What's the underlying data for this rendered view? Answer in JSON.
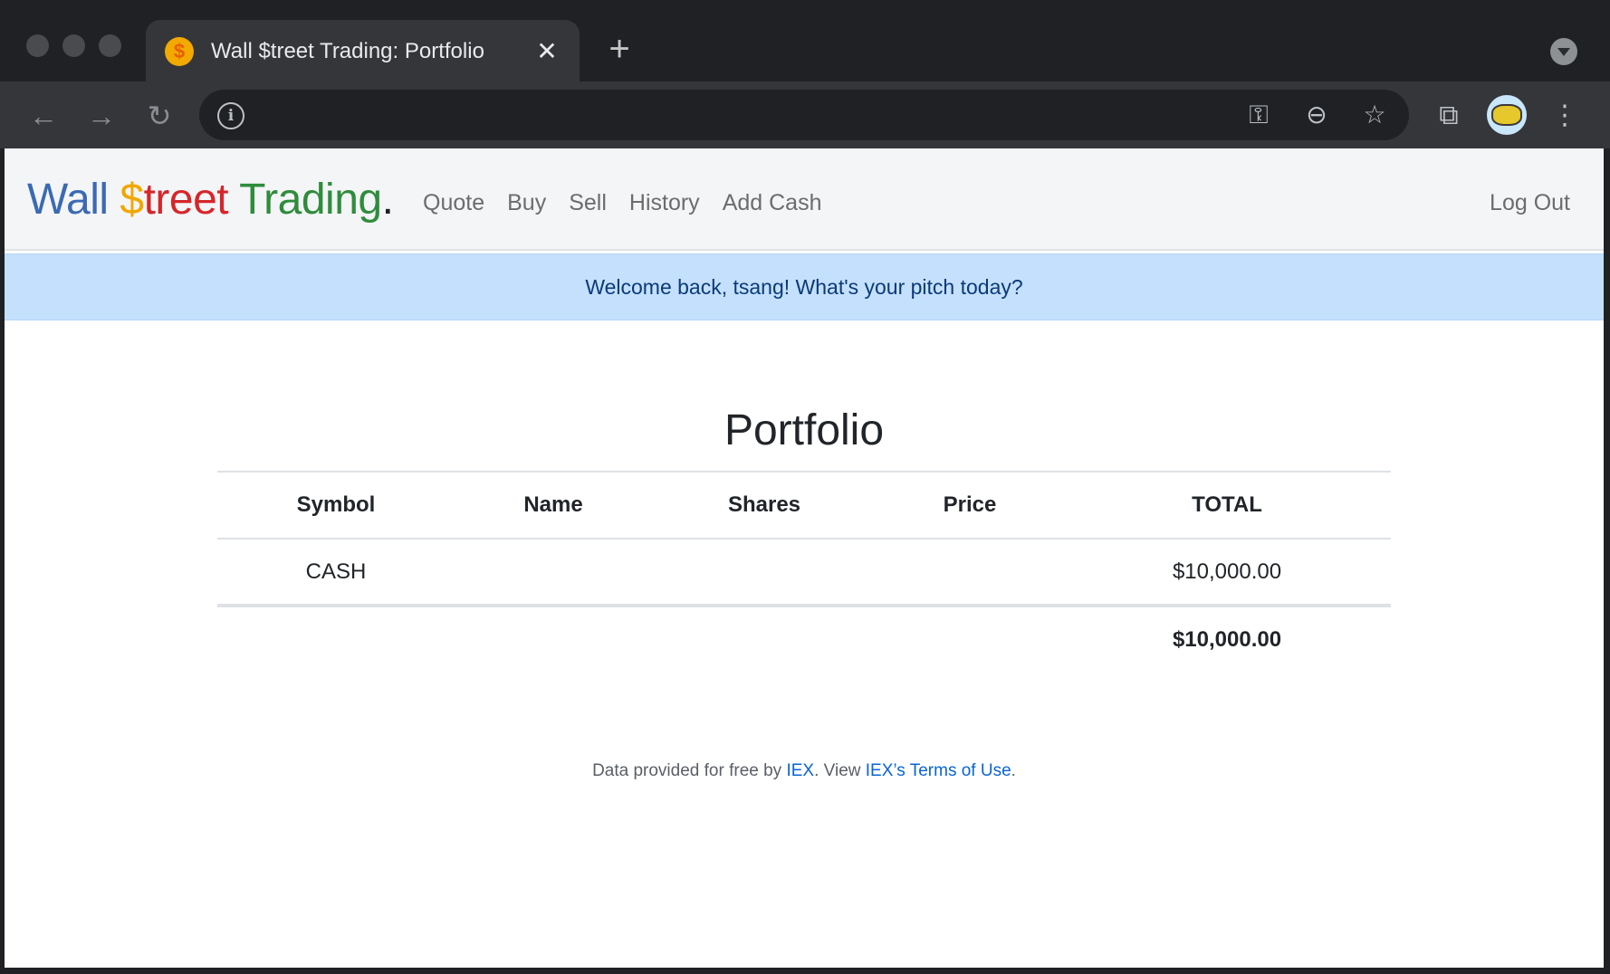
{
  "browser": {
    "tab_title": "Wall $treet Trading: Portfolio",
    "tab_close": "✕",
    "new_tab": "+",
    "nav_back": "←",
    "nav_forward": "→",
    "nav_reload": "↻",
    "info_glyph": "i",
    "key_glyph": "⚿",
    "zoom_glyph": "⊖",
    "star_glyph": "☆",
    "extensions_glyph": "⧉",
    "menu_glyph": "⋮"
  },
  "navbar": {
    "brand_part1": "Wall",
    "brand_part2": "$",
    "brand_part3": "treet",
    "brand_part4": "Trading",
    "brand_part5": ".",
    "links": [
      "Quote",
      "Buy",
      "Sell",
      "History",
      "Add Cash"
    ],
    "logout": "Log Out"
  },
  "alert": {
    "message": "Welcome back, tsang! What's your pitch today?"
  },
  "main": {
    "title": "Portfolio",
    "table": {
      "headers": [
        "Symbol",
        "Name",
        "Shares",
        "Price",
        "TOTAL"
      ],
      "rows": [
        [
          "CASH",
          "",
          "",
          "",
          "$10,000.00"
        ]
      ],
      "grand_total": "$10,000.00"
    }
  },
  "footer": {
    "prefix": "Data provided for free by",
    "iex_link": "IEX",
    "middle": ". View",
    "terms_link": "IEX’s Terms of Use",
    "suffix": "."
  },
  "colors": {
    "brand_blue": "#3b6ab3",
    "brand_yellow": "#f0a800",
    "brand_red": "#d6262a",
    "brand_green": "#2f8c3c",
    "alert_bg": "#c4e0fd",
    "link": "#0a64d6"
  },
  "icons": {
    "favicon": "coin-icon",
    "avatar": "profile-avatar"
  }
}
